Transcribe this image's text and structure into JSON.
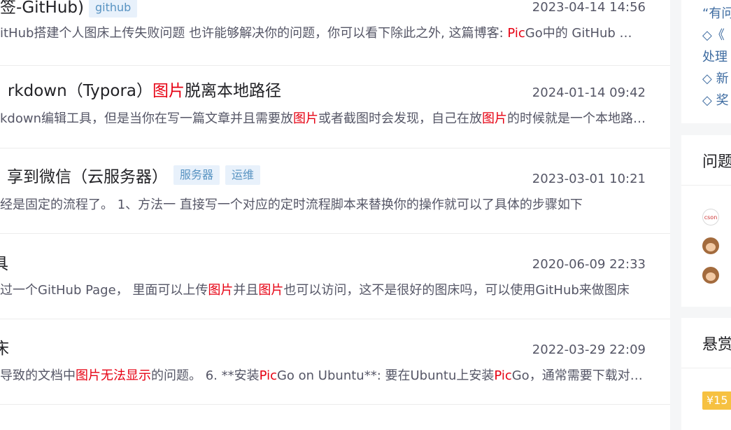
{
  "results": [
    {
      "title": "签-GitHub)",
      "tags": [
        "github"
      ],
      "date": "2023-04-14 14:56",
      "desc": [
        {
          "t": "itHub搭建个人图床上传失败问题 也许能够解决你的问题，你可以看下除此之外, 这篇博客: ",
          "h": false
        },
        {
          "t": "Pic",
          "h": true
        },
        {
          "t": "Go中的 GitHub 图床配置失败问题的解决方法也许可以帮助到你",
          "h": false
        }
      ]
    },
    {
      "title_parts": [
        {
          "t": "rkdown（Typora）",
          "h": false
        },
        {
          "t": "图片",
          "h": true
        },
        {
          "t": "脱离本地路径",
          "h": false
        }
      ],
      "tags": [],
      "date": "2024-01-14 09:42",
      "desc": [
        {
          "t": "kdown编辑工具，但是当你在写一篇文章并且需要放",
          "h": false
        },
        {
          "t": "图片",
          "h": true
        },
        {
          "t": "或者截图时会发现，自己在放",
          "h": false
        },
        {
          "t": "图片",
          "h": true
        },
        {
          "t": "的时候就是一个本地路径的地址问题",
          "h": false
        }
      ]
    },
    {
      "title": "享到微信（云服务器）",
      "tags": [
        "服务器",
        "运维"
      ],
      "date": "2023-03-01 10:21",
      "desc": [
        {
          "t": "经是固定的流程了。 1、方法一 直接写一个对应的定时流程脚本来替换你的操作就可以了具体的步骤如下",
          "h": false
        }
      ]
    },
    {
      "title": "具",
      "tags": [],
      "date": "2020-06-09 22:33",
      "desc": [
        {
          "t": "过一个GitHub Page， 里面可以上传",
          "h": false
        },
        {
          "t": "图片",
          "h": true
        },
        {
          "t": "并且",
          "h": false
        },
        {
          "t": "图片",
          "h": true
        },
        {
          "t": "也可以访问，这不是很好的图床吗，可以使用GitHub来做图床",
          "h": false
        }
      ]
    },
    {
      "title": "床",
      "tags": [],
      "date": "2022-03-29 22:09",
      "desc": [
        {
          "t": "导致的文档中",
          "h": false
        },
        {
          "t": "图片无法显示",
          "h": true
        },
        {
          "t": "的问题。 6. **安装",
          "h": false
        },
        {
          "t": "Pic",
          "h": true
        },
        {
          "t": "Go on Ubuntu**: 要在Ubuntu上安装",
          "h": false
        },
        {
          "t": "Pic",
          "h": true
        },
        {
          "t": "Go，通常需要下载对应的安装包",
          "h": false
        }
      ]
    }
  ],
  "sidebar": {
    "lines": [
      "“有问",
      "◇《",
      "处理",
      "◇ 新",
      "◇ 奖"
    ],
    "question_heading": "问题",
    "avatar_label": "cson",
    "reward_heading": "悬赏",
    "reward_badge": "¥15"
  }
}
